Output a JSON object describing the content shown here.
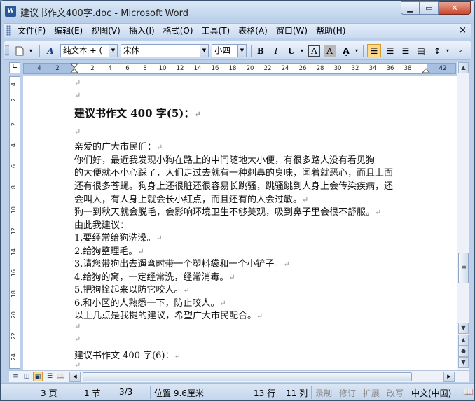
{
  "window": {
    "title": "建议书作文400字.doc - Microsoft Word",
    "app_icon": "W"
  },
  "menu": {
    "items": [
      "文件(F)",
      "编辑(E)",
      "视图(V)",
      "插入(I)",
      "格式(O)",
      "工具(T)",
      "表格(A)",
      "窗口(W)",
      "帮助(H)"
    ],
    "close_glyph": "×"
  },
  "toolbar": {
    "style_value": "纯文本 + (",
    "font_value": "宋体",
    "size_value": "小四",
    "bold": "B",
    "italic": "I",
    "underline": "U",
    "char_border": "A",
    "char_shading": "A"
  },
  "ruler": {
    "h_ticks": [
      "4",
      "2",
      "2",
      "4",
      "6",
      "8",
      "10",
      "12",
      "14",
      "16",
      "18",
      "20",
      "22",
      "24",
      "26",
      "28",
      "30",
      "32",
      "34",
      "36",
      "38",
      "42"
    ],
    "v_ticks": [
      "4",
      "2",
      "2",
      "4",
      "6",
      "8",
      "10",
      "12",
      "14",
      "16",
      "18",
      "20",
      "22",
      "24"
    ]
  },
  "document": {
    "lines": [
      "",
      "建议书作文 400 字(5)：",
      "",
      "亲爱的广大市民们：",
      "    你们好，最近我发现小狗在路上的中间随地大小便，有很多路人没有看见狗",
      "的大便就不小心踩了，人们走过去就有一种刺鼻的臭味，闻着就恶心，而且上面",
      "还有很多苍蝇。狗身上还很脏还很容易长跳骚，跳骚跳到人身上会传染疾病，还",
      "会叫人，有人身上就会长小红点，而且还有的人会过敏。",
      "    狗一到秋天就会脱毛，会影响环境卫生不够美观，吸到鼻子里会很不舒服。",
      "    由此我建议：",
      "    1.要经常给狗洗澡。",
      "    2.给狗整理毛。",
      "    3.请您带狗出去遛弯时带一个塑料袋和一个小铲子。",
      "    4.给狗的窝，一定经常洗，经常消毒。",
      "    5.把狗拴起来以防它咬人。",
      "    6.和小区的人熟悉一下，防止咬人。",
      "    以上几点是我提的建议，希望广大市民配合。",
      "",
      "",
      "建议书作文 400 字(6)：",
      ""
    ]
  },
  "status": {
    "page": "3 页",
    "section": "1 节",
    "page_of": "3/3",
    "position": "位置 9.6厘米",
    "line": "13 行",
    "column": "11 列",
    "rec": "录制",
    "trk": "修订",
    "ext": "扩展",
    "ovr": "改写",
    "language": "中文(中国)"
  }
}
